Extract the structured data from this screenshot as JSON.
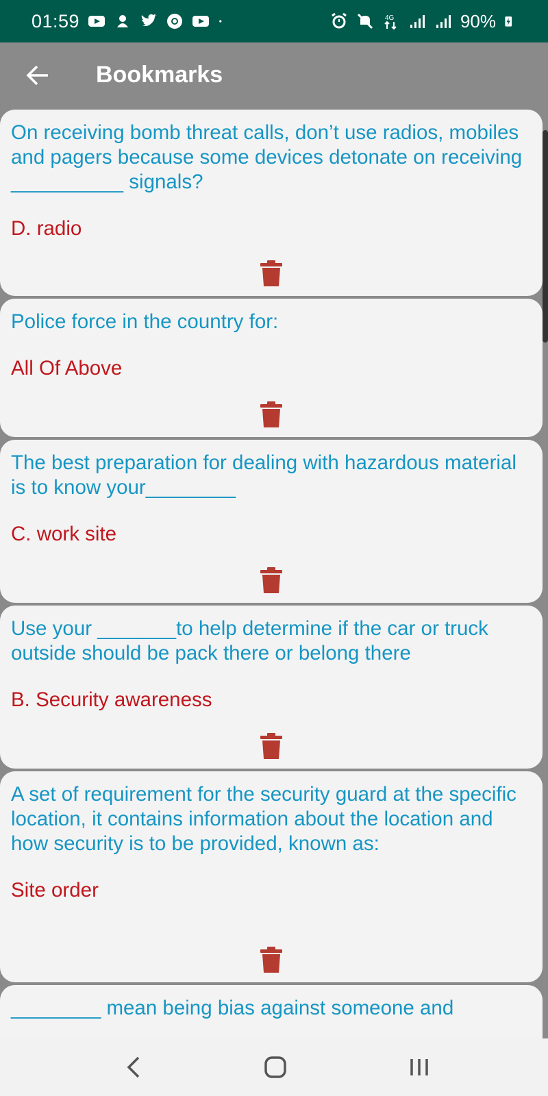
{
  "status_bar": {
    "time": "01:59",
    "battery": "90%",
    "left_icons": [
      "youtube-icon",
      "notification-icon",
      "twitter-icon",
      "chrome-icon",
      "youtube-icon",
      "dot-icon"
    ],
    "right_icons": [
      "alarm-icon",
      "mute-icon",
      "4g-icon",
      "signal-icon",
      "signal-icon",
      "battery-charging-icon"
    ]
  },
  "app_bar": {
    "title": "Bookmarks",
    "back_icon": "arrow-left-icon"
  },
  "bookmarks": [
    {
      "question": "On receiving bomb threat calls, don’t use radios, mobiles and pagers because some devices detonate on receiving __________ signals?",
      "answer": "D. radio"
    },
    {
      "question": "Police force in the country for:",
      "answer": "All Of Above"
    },
    {
      "question": "The best preparation for dealing with hazardous material is to know your________",
      "answer": "C. work site"
    },
    {
      "question": "Use your _______to help determine if the car or truck outside should be pack there or belong there",
      "answer": "B. Security awareness"
    },
    {
      "question": "A set of requirement for the security guard at the specific location, it contains information about the location and how security is to be provided, known as:",
      "answer": "Site order"
    },
    {
      "question": "________ mean being bias against someone and",
      "answer": ""
    }
  ],
  "colors": {
    "status_bar": "#005a4c",
    "app_bar": "#8a8a8a",
    "question_text": "#1696c4",
    "answer_text": "#c0171d",
    "trash_icon": "#b53a2f",
    "card": "#f3f3f3"
  },
  "nav_bar": {
    "icons": [
      "nav-back-icon",
      "nav-home-icon",
      "nav-recents-icon"
    ]
  }
}
